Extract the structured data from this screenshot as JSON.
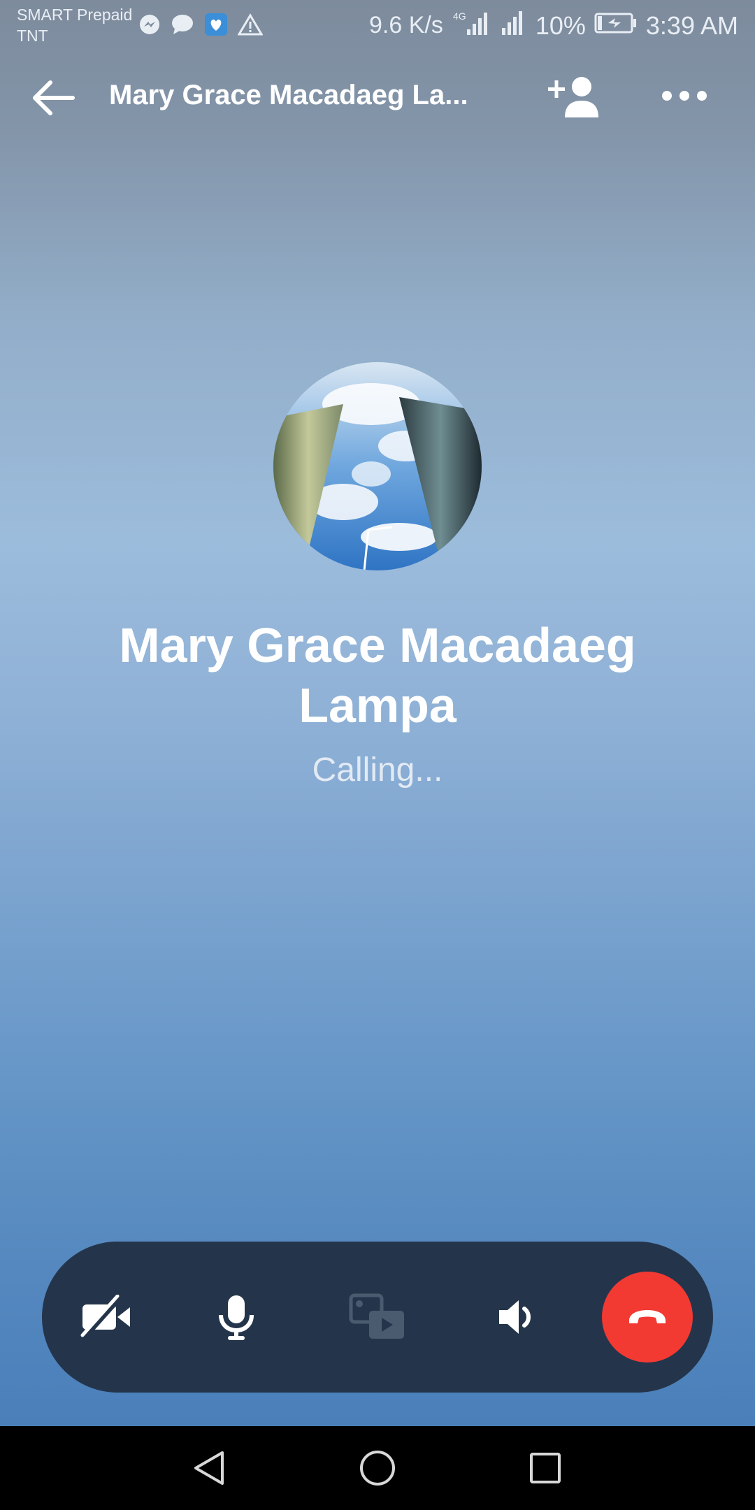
{
  "status_bar": {
    "carrier_line1": "SMART Prepaid",
    "carrier_line2": "TNT",
    "net_speed": "9.6 K/s",
    "network_type": "4G",
    "battery": "10%",
    "time": "3:39 AM",
    "icons": [
      "messenger-icon",
      "chat-bubble-icon",
      "app-notification-icon",
      "warning-icon",
      "signal-4g-icon",
      "signal-icon",
      "battery-charging-icon"
    ]
  },
  "header": {
    "title": "Mary Grace Macadaeg La...",
    "icons": [
      "back-arrow-icon",
      "add-person-icon",
      "more-icon"
    ]
  },
  "call": {
    "contact_name": "Mary Grace Macadaeg Lampa",
    "status": "Calling..."
  },
  "controls": {
    "icons": [
      "video-off-icon",
      "microphone-icon",
      "media-share-icon",
      "speaker-icon",
      "end-call-icon"
    ],
    "media_share_enabled": false,
    "end_call_color": "#f23a33",
    "bar_color": "#24354b"
  },
  "nav_bar": {
    "icons": [
      "nav-back-icon",
      "nav-home-icon",
      "nav-recents-icon"
    ]
  }
}
